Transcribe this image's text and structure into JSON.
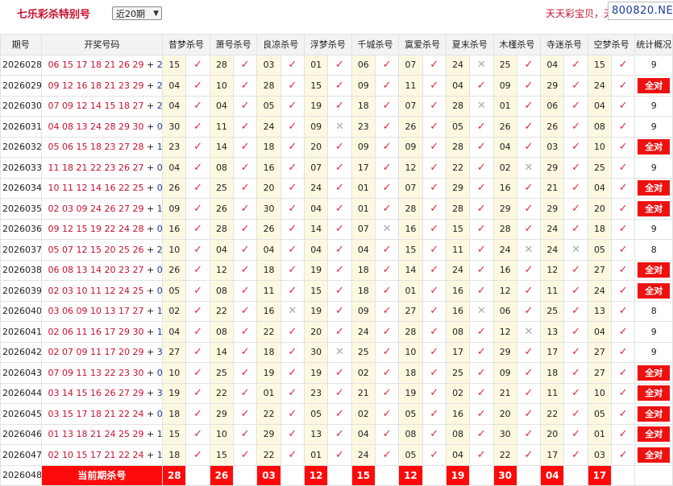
{
  "header": {
    "title": "七乐彩杀特别号",
    "period_select": "近20期",
    "slogan": "天天彩宝贝，天天",
    "site": "800820.NET"
  },
  "columns": [
    "期号",
    "开奖号码",
    "昔梦杀号",
    "萧号杀号",
    "良凉杀号",
    "浮梦杀号",
    "千城杀号",
    "寞爱杀号",
    "夏末杀号",
    "木槿杀号",
    "寺迷杀号",
    "空梦杀号",
    "统计概况"
  ],
  "rows": [
    {
      "p": "2026028",
      "n": "06 15 17 18 21 26 29",
      "sp": "24",
      "k": [
        [
          "15",
          "ok"
        ],
        [
          "28",
          "ok"
        ],
        [
          "03",
          "ok"
        ],
        [
          "01",
          "ok"
        ],
        [
          "06",
          "ok"
        ],
        [
          "07",
          "ok"
        ],
        [
          "24",
          "no"
        ],
        [
          "25",
          "ok"
        ],
        [
          "04",
          "ok"
        ],
        [
          "15",
          "ok"
        ]
      ],
      "s": "9"
    },
    {
      "p": "2026029",
      "n": "09 12 16 18 21 23 29",
      "sp": "26",
      "k": [
        [
          "04",
          "ok"
        ],
        [
          "10",
          "ok"
        ],
        [
          "28",
          "ok"
        ],
        [
          "15",
          "ok"
        ],
        [
          "09",
          "ok"
        ],
        [
          "11",
          "ok"
        ],
        [
          "04",
          "ok"
        ],
        [
          "09",
          "ok"
        ],
        [
          "29",
          "ok"
        ],
        [
          "24",
          "ok"
        ]
      ],
      "s": "全对"
    },
    {
      "p": "2026030",
      "n": "07 09 12 14 15 18 27",
      "sp": "28",
      "k": [
        [
          "04",
          "ok"
        ],
        [
          "04",
          "ok"
        ],
        [
          "05",
          "ok"
        ],
        [
          "19",
          "ok"
        ],
        [
          "18",
          "ok"
        ],
        [
          "07",
          "ok"
        ],
        [
          "28",
          "no"
        ],
        [
          "01",
          "ok"
        ],
        [
          "06",
          "ok"
        ],
        [
          "04",
          "ok"
        ]
      ],
      "s": "9"
    },
    {
      "p": "2026031",
      "n": "04 08 13 24 28 29 30",
      "sp": "09",
      "k": [
        [
          "30",
          "ok"
        ],
        [
          "11",
          "ok"
        ],
        [
          "24",
          "ok"
        ],
        [
          "09",
          "no"
        ],
        [
          "23",
          "ok"
        ],
        [
          "26",
          "ok"
        ],
        [
          "05",
          "ok"
        ],
        [
          "26",
          "ok"
        ],
        [
          "26",
          "ok"
        ],
        [
          "08",
          "ok"
        ]
      ],
      "s": "9"
    },
    {
      "p": "2026032",
      "n": "05 06 15 18 23 27 28",
      "sp": "19",
      "k": [
        [
          "23",
          "ok"
        ],
        [
          "14",
          "ok"
        ],
        [
          "18",
          "ok"
        ],
        [
          "20",
          "ok"
        ],
        [
          "09",
          "ok"
        ],
        [
          "09",
          "ok"
        ],
        [
          "28",
          "ok"
        ],
        [
          "04",
          "ok"
        ],
        [
          "03",
          "ok"
        ],
        [
          "10",
          "ok"
        ]
      ],
      "s": "全对"
    },
    {
      "p": "2026033",
      "n": "11 18 21 22 23 26 27",
      "sp": "02",
      "k": [
        [
          "04",
          "ok"
        ],
        [
          "08",
          "ok"
        ],
        [
          "16",
          "ok"
        ],
        [
          "07",
          "ok"
        ],
        [
          "17",
          "ok"
        ],
        [
          "12",
          "ok"
        ],
        [
          "22",
          "ok"
        ],
        [
          "02",
          "no"
        ],
        [
          "29",
          "ok"
        ],
        [
          "25",
          "ok"
        ]
      ],
      "s": "9"
    },
    {
      "p": "2026034",
      "n": "10 11 12 14 16 22 25",
      "sp": "03",
      "k": [
        [
          "26",
          "ok"
        ],
        [
          "25",
          "ok"
        ],
        [
          "20",
          "ok"
        ],
        [
          "24",
          "ok"
        ],
        [
          "01",
          "ok"
        ],
        [
          "07",
          "ok"
        ],
        [
          "29",
          "ok"
        ],
        [
          "16",
          "ok"
        ],
        [
          "21",
          "ok"
        ],
        [
          "04",
          "ok"
        ]
      ],
      "s": "全对"
    },
    {
      "p": "2026035",
      "n": "02 03 09 24 26 27 29",
      "sp": "14",
      "k": [
        [
          "09",
          "ok"
        ],
        [
          "26",
          "ok"
        ],
        [
          "30",
          "ok"
        ],
        [
          "04",
          "ok"
        ],
        [
          "01",
          "ok"
        ],
        [
          "28",
          "ok"
        ],
        [
          "28",
          "ok"
        ],
        [
          "29",
          "ok"
        ],
        [
          "29",
          "ok"
        ],
        [
          "20",
          "ok"
        ]
      ],
      "s": "全对"
    },
    {
      "p": "2026036",
      "n": "09 12 15 19 22 24 28",
      "sp": "07",
      "k": [
        [
          "16",
          "ok"
        ],
        [
          "28",
          "ok"
        ],
        [
          "26",
          "ok"
        ],
        [
          "14",
          "ok"
        ],
        [
          "07",
          "no"
        ],
        [
          "16",
          "ok"
        ],
        [
          "15",
          "ok"
        ],
        [
          "28",
          "ok"
        ],
        [
          "24",
          "ok"
        ],
        [
          "18",
          "ok"
        ]
      ],
      "s": "9"
    },
    {
      "p": "2026037",
      "n": "05 07 12 15 20 25 26",
      "sp": "24",
      "k": [
        [
          "10",
          "ok"
        ],
        [
          "04",
          "ok"
        ],
        [
          "04",
          "ok"
        ],
        [
          "04",
          "ok"
        ],
        [
          "04",
          "ok"
        ],
        [
          "15",
          "ok"
        ],
        [
          "11",
          "ok"
        ],
        [
          "24",
          "no"
        ],
        [
          "24",
          "no"
        ],
        [
          "05",
          "ok"
        ]
      ],
      "s": "8"
    },
    {
      "p": "2026038",
      "n": "06 08 13 14 20 23 27",
      "sp": "01",
      "k": [
        [
          "26",
          "ok"
        ],
        [
          "12",
          "ok"
        ],
        [
          "18",
          "ok"
        ],
        [
          "19",
          "ok"
        ],
        [
          "18",
          "ok"
        ],
        [
          "14",
          "ok"
        ],
        [
          "24",
          "ok"
        ],
        [
          "16",
          "ok"
        ],
        [
          "12",
          "ok"
        ],
        [
          "27",
          "ok"
        ]
      ],
      "s": "全对"
    },
    {
      "p": "2026039",
      "n": "02 03 10 11 12 24 25",
      "sp": "07",
      "k": [
        [
          "05",
          "ok"
        ],
        [
          "08",
          "ok"
        ],
        [
          "11",
          "ok"
        ],
        [
          "15",
          "ok"
        ],
        [
          "18",
          "ok"
        ],
        [
          "01",
          "ok"
        ],
        [
          "16",
          "ok"
        ],
        [
          "12",
          "ok"
        ],
        [
          "11",
          "ok"
        ],
        [
          "24",
          "ok"
        ]
      ],
      "s": "全对"
    },
    {
      "p": "2026040",
      "n": "03 06 09 10 13 17 27",
      "sp": "16",
      "k": [
        [
          "02",
          "ok"
        ],
        [
          "22",
          "ok"
        ],
        [
          "16",
          "no"
        ],
        [
          "19",
          "ok"
        ],
        [
          "09",
          "ok"
        ],
        [
          "27",
          "ok"
        ],
        [
          "16",
          "no"
        ],
        [
          "06",
          "ok"
        ],
        [
          "25",
          "ok"
        ],
        [
          "13",
          "ok"
        ]
      ],
      "s": "8"
    },
    {
      "p": "2026041",
      "n": "02 06 11 16 17 29 30",
      "sp": "12",
      "k": [
        [
          "04",
          "ok"
        ],
        [
          "08",
          "ok"
        ],
        [
          "22",
          "ok"
        ],
        [
          "20",
          "ok"
        ],
        [
          "24",
          "ok"
        ],
        [
          "28",
          "ok"
        ],
        [
          "08",
          "ok"
        ],
        [
          "12",
          "no"
        ],
        [
          "13",
          "ok"
        ],
        [
          "04",
          "ok"
        ]
      ],
      "s": "9"
    },
    {
      "p": "2026042",
      "n": "02 07 09 11 17 20 29",
      "sp": "30",
      "k": [
        [
          "27",
          "ok"
        ],
        [
          "14",
          "ok"
        ],
        [
          "18",
          "ok"
        ],
        [
          "30",
          "no"
        ],
        [
          "25",
          "ok"
        ],
        [
          "10",
          "ok"
        ],
        [
          "17",
          "ok"
        ],
        [
          "29",
          "ok"
        ],
        [
          "17",
          "ok"
        ],
        [
          "27",
          "ok"
        ]
      ],
      "s": "9"
    },
    {
      "p": "2026043",
      "n": "07 09 11 13 22 23 30",
      "sp": "06",
      "k": [
        [
          "10",
          "ok"
        ],
        [
          "25",
          "ok"
        ],
        [
          "19",
          "ok"
        ],
        [
          "19",
          "ok"
        ],
        [
          "02",
          "ok"
        ],
        [
          "18",
          "ok"
        ],
        [
          "25",
          "ok"
        ],
        [
          "09",
          "ok"
        ],
        [
          "18",
          "ok"
        ],
        [
          "27",
          "ok"
        ]
      ],
      "s": "全对"
    },
    {
      "p": "2026044",
      "n": "03 14 15 16 26 27 29",
      "sp": "30",
      "k": [
        [
          "19",
          "ok"
        ],
        [
          "22",
          "ok"
        ],
        [
          "01",
          "ok"
        ],
        [
          "23",
          "ok"
        ],
        [
          "21",
          "ok"
        ],
        [
          "19",
          "ok"
        ],
        [
          "02",
          "ok"
        ],
        [
          "21",
          "ok"
        ],
        [
          "11",
          "ok"
        ],
        [
          "10",
          "ok"
        ]
      ],
      "s": "全对"
    },
    {
      "p": "2026045",
      "n": "03 15 17 18 21 22 24",
      "sp": "08",
      "k": [
        [
          "18",
          "ok"
        ],
        [
          "29",
          "ok"
        ],
        [
          "22",
          "ok"
        ],
        [
          "05",
          "ok"
        ],
        [
          "02",
          "ok"
        ],
        [
          "05",
          "ok"
        ],
        [
          "16",
          "ok"
        ],
        [
          "20",
          "ok"
        ],
        [
          "22",
          "ok"
        ],
        [
          "05",
          "ok"
        ]
      ],
      "s": "全对"
    },
    {
      "p": "2026046",
      "n": "01 13 18 21 24 25 29",
      "sp": "14",
      "k": [
        [
          "15",
          "ok"
        ],
        [
          "10",
          "ok"
        ],
        [
          "29",
          "ok"
        ],
        [
          "13",
          "ok"
        ],
        [
          "04",
          "ok"
        ],
        [
          "08",
          "ok"
        ],
        [
          "08",
          "ok"
        ],
        [
          "30",
          "ok"
        ],
        [
          "20",
          "ok"
        ],
        [
          "01",
          "ok"
        ]
      ],
      "s": "全对"
    },
    {
      "p": "2026047",
      "n": "02 10 15 17 21 22 24",
      "sp": "13",
      "k": [
        [
          "18",
          "ok"
        ],
        [
          "15",
          "ok"
        ],
        [
          "22",
          "ok"
        ],
        [
          "01",
          "ok"
        ],
        [
          "24",
          "ok"
        ],
        [
          "05",
          "ok"
        ],
        [
          "04",
          "ok"
        ],
        [
          "22",
          "ok"
        ],
        [
          "17",
          "ok"
        ],
        [
          "03",
          "ok"
        ]
      ],
      "s": "全对"
    }
  ],
  "current": {
    "p": "2026048",
    "label": "当前期杀号",
    "kills": [
      "28",
      "26",
      "03",
      "12",
      "15",
      "12",
      "19",
      "30",
      "04",
      "17"
    ]
  },
  "glyphs": {
    "ok": "✓",
    "no": "✕"
  },
  "colors": {
    "red": "#e8253a",
    "kill_bg": "#fdf9e0",
    "badge": "#ee1111"
  }
}
